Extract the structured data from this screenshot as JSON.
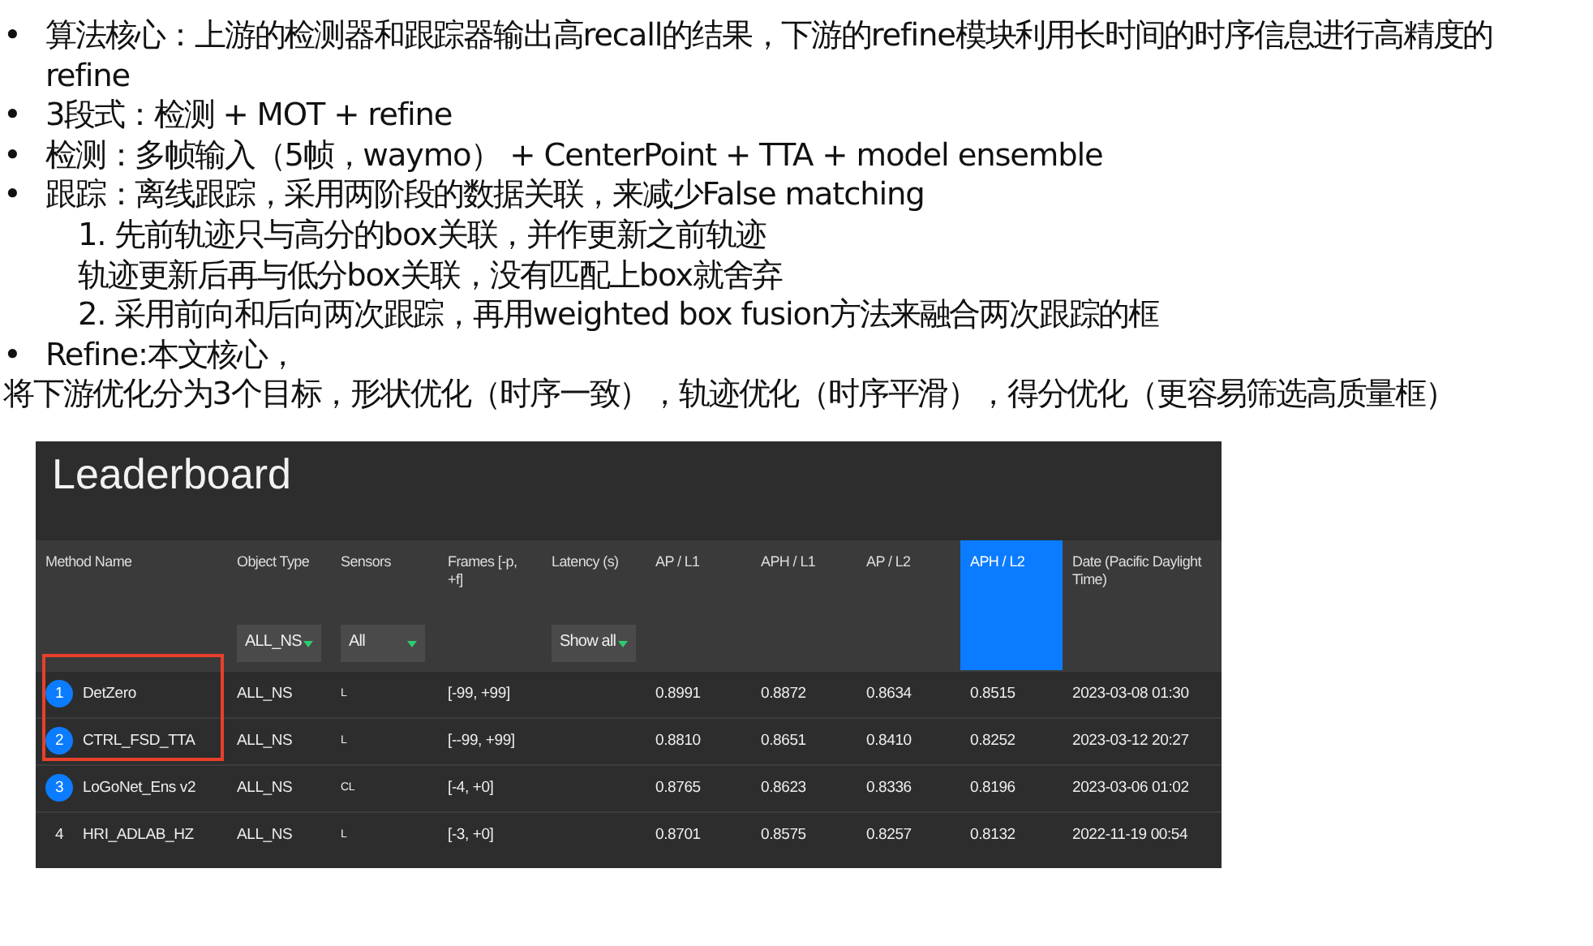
{
  "slide": {
    "lines": [
      {
        "kind": "bullet",
        "marker": "•",
        "text": "算法核心：上游的检测器和跟踪器输出高recall的结果，下游的refine模块利用长时间的时序信息进行高精度的refine"
      },
      {
        "kind": "bullet",
        "marker": "•",
        "text": "3段式：检测 + MOT + refine"
      },
      {
        "kind": "bullet",
        "marker": "•",
        "text": "检测：多帧输入（5帧，waymo） + CenterPoint + TTA + model ensemble"
      },
      {
        "kind": "bullet",
        "marker": "•",
        "text": "跟踪：离线跟踪，采用两阶段的数据关联，来减少False matching"
      },
      {
        "kind": "indented",
        "text": "1. 先前轨迹只与高分的box关联，并作更新之前轨迹"
      },
      {
        "kind": "indented",
        "text": "轨迹更新后再与低分box关联，没有匹配上box就舍弃"
      },
      {
        "kind": "indented",
        "text": "2. 采用前向和后向两次跟踪，再用weighted box fusion方法来融合两次跟踪的框"
      },
      {
        "kind": "bullet",
        "marker": "•",
        "text": "Refine:本文核心，"
      },
      {
        "kind": "plain",
        "text": "将下游优化分为3个目标，形状优化（时序一致），轨迹优化（时序平滑），得分优化（更容易筛选高质量框）"
      }
    ]
  },
  "leaderboard": {
    "title": "Leaderboard",
    "columns": [
      {
        "label": "Method Name",
        "selected": false
      },
      {
        "label": "Object Type",
        "selected": false,
        "filter": "ALL_NS"
      },
      {
        "label": "Sensors",
        "selected": false,
        "filter": "All"
      },
      {
        "label": "Frames [-p, +f]",
        "selected": false
      },
      {
        "label": "Latency (s)",
        "selected": false,
        "filter": "Show all"
      },
      {
        "label": "AP / L1",
        "selected": false
      },
      {
        "label": "APH / L1",
        "selected": false
      },
      {
        "label": "AP / L2",
        "selected": false
      },
      {
        "label": "APH / L2",
        "selected": true
      },
      {
        "label": "Date (Pacific Daylight Time)",
        "selected": false
      }
    ],
    "rows": [
      {
        "rank": "1",
        "kind": "badge",
        "highlighted": true,
        "cells": [
          "DetZero",
          "ALL_NS",
          "L",
          "[-99, +99]",
          "",
          "0.8991",
          "0.8872",
          "0.8634",
          "0.8515",
          "2023-03-08 01:30"
        ]
      },
      {
        "rank": "2",
        "kind": "badge",
        "highlighted": true,
        "cells": [
          "CTRL_FSD_TTA",
          "ALL_NS",
          "L",
          "[--99, +99]",
          "",
          "0.8810",
          "0.8651",
          "0.8410",
          "0.8252",
          "2023-03-12 20:27"
        ]
      },
      {
        "rank": "3",
        "kind": "badge",
        "highlighted": false,
        "cells": [
          "LoGoNet_Ens v2",
          "ALL_NS",
          "CL",
          "[-4, +0]",
          "",
          "0.8765",
          "0.8623",
          "0.8336",
          "0.8196",
          "2023-03-06 01:02"
        ]
      },
      {
        "rank": "4",
        "kind": "plain",
        "highlighted": false,
        "cells": [
          "HRI_ADLAB_HZ",
          "ALL_NS",
          "L",
          "[-3, +0]",
          "",
          "0.8701",
          "0.8575",
          "0.8257",
          "0.8132",
          "2022-11-19 00:54"
        ]
      }
    ]
  }
}
